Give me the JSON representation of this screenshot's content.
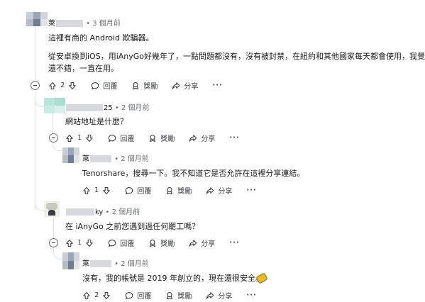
{
  "comments": [
    {
      "meta": "• 3 個月前",
      "name_prefix": "萊",
      "body_lines": [
        "這裡有商的 Android 欺騙器。",
        "",
        "從安卓換到iOS，用iAnyGo好幾年了，一點問題都沒有，沒有被封禁，在紐約和其他國家每天都會使用，我覺得",
        "還不錯，一直在用。"
      ],
      "votes": "2",
      "reply_label": "回覆",
      "award_label": "獎勵",
      "share_label": "分享",
      "more_label": "···"
    },
    {
      "name_suffix": "25",
      "meta": "• 2 個月前",
      "body_lines": [
        "網站地址是什麼？"
      ],
      "votes": "1",
      "reply_label": "回覆",
      "award_label": "獎勵",
      "share_label": "分享",
      "more_label": "···"
    },
    {
      "name_prefix": "萊",
      "meta": "• 2 個月前",
      "body_lines": [
        "Tenorshare，搜尋一下。我不知道它是否允許在這裡分享連結。"
      ],
      "votes": "1",
      "reply_label": "回覆",
      "award_label": "獎勵",
      "share_label": "分享",
      "more_label": "···"
    },
    {
      "name_suffix": "ky",
      "meta": "• 2 個月前",
      "body_lines": [
        "在 iAnyGo 之前您遇到過任何罷工嗎？"
      ],
      "votes": "1",
      "reply_label": "回覆",
      "award_label": "獎勵",
      "share_label": "分享",
      "more_label": "···"
    },
    {
      "name_prefix": "萊",
      "meta": "• 2 個月前",
      "body_lines": [
        "沒有，我的帳號是 2019 年創立的，現在還很安全。"
      ],
      "votes": "2",
      "reply_label": "回覆",
      "award_label": "獎勵",
      "share_label": "分享",
      "more_label": "···"
    }
  ],
  "icons": {
    "upvote": "arrow-up-icon",
    "downvote": "arrow-down-icon",
    "reply": "speech-bubble-icon",
    "award": "award-icon",
    "share": "share-icon",
    "collapse": "collapse-minus-icon",
    "emoji": "coin-emoji"
  },
  "colors": {
    "text": "#1a1a1b",
    "meta": "#6c7074",
    "thread_line": "#e0e2e5",
    "redaction": "#d6d9dd"
  }
}
